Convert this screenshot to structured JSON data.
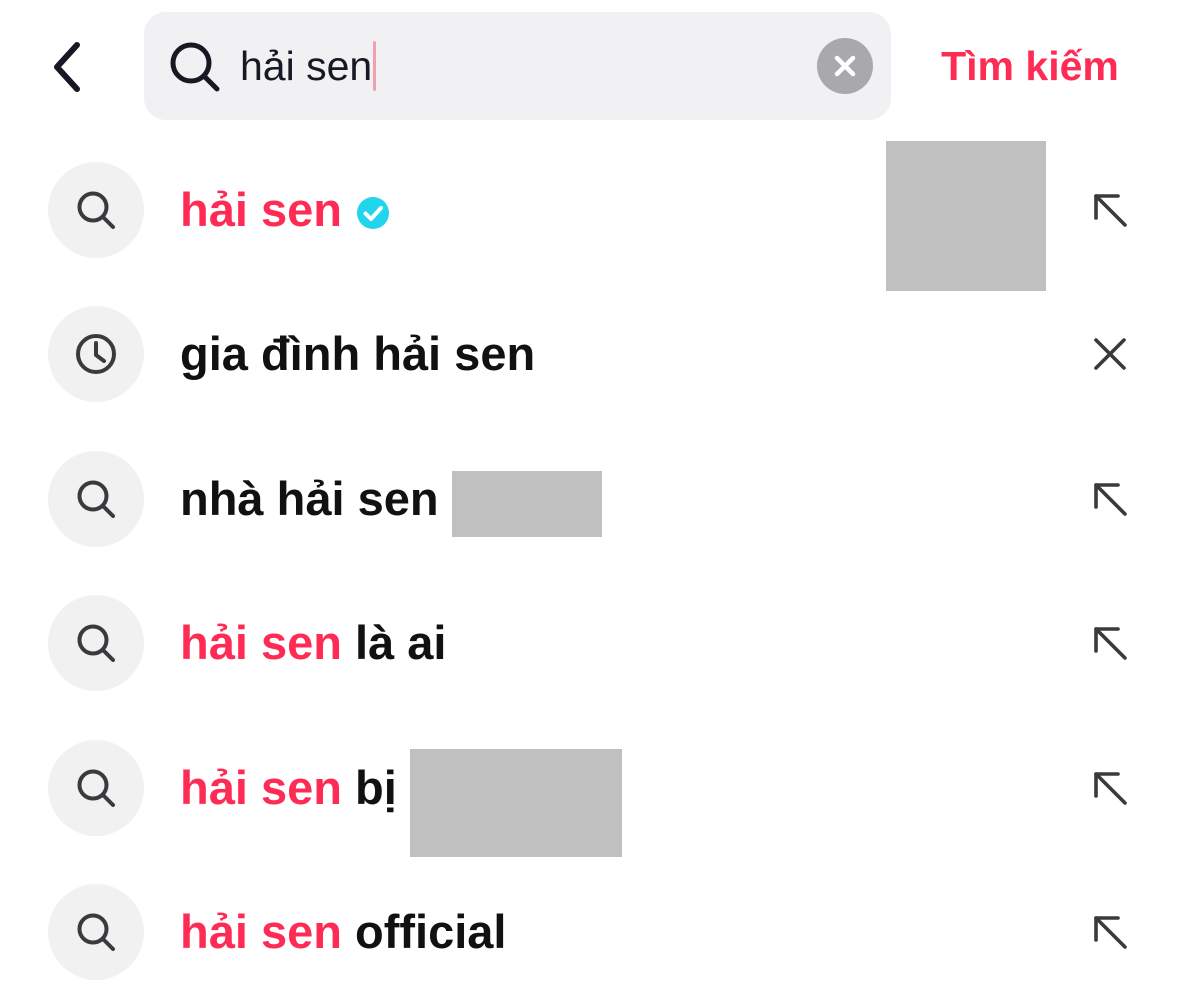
{
  "search": {
    "query": "hải sen",
    "submit_label": "Tìm kiếm"
  },
  "suggestions": [
    {
      "kind": "search",
      "highlight": "hải sen",
      "rest": "",
      "verified": true,
      "redacted": false,
      "thumbnail": true,
      "action": "fill-arrow"
    },
    {
      "kind": "history",
      "highlight": "",
      "rest": "gia đình hải sen",
      "verified": false,
      "redacted": false,
      "thumbnail": false,
      "action": "remove"
    },
    {
      "kind": "search",
      "highlight": "",
      "rest": "nhà hải sen ",
      "verified": false,
      "redacted": true,
      "thumbnail": false,
      "action": "fill-arrow"
    },
    {
      "kind": "search",
      "highlight": "hải sen",
      "rest": " là ai",
      "verified": false,
      "redacted": false,
      "thumbnail": false,
      "action": "fill-arrow"
    },
    {
      "kind": "search",
      "highlight": "hải sen",
      "rest": " bị ",
      "verified": false,
      "redacted": true,
      "thumbnail": false,
      "action": "fill-arrow"
    },
    {
      "kind": "search",
      "highlight": "hải sen",
      "rest": " official",
      "verified": false,
      "redacted": false,
      "thumbnail": false,
      "action": "fill-arrow"
    }
  ],
  "icons": {
    "back": "chevron-left-icon",
    "search": "search-icon",
    "clear": "clear-circle-icon",
    "history": "clock-icon",
    "verified": "verified-check-icon",
    "fill": "arrow-up-left-icon",
    "remove": "close-icon"
  },
  "colors": {
    "accent": "#fe2c55",
    "verified": "#20d5ec",
    "search_field_bg": "#f1f1f4",
    "icon_circle_bg": "#f1f1f2",
    "redaction": "#c0c0c0"
  }
}
